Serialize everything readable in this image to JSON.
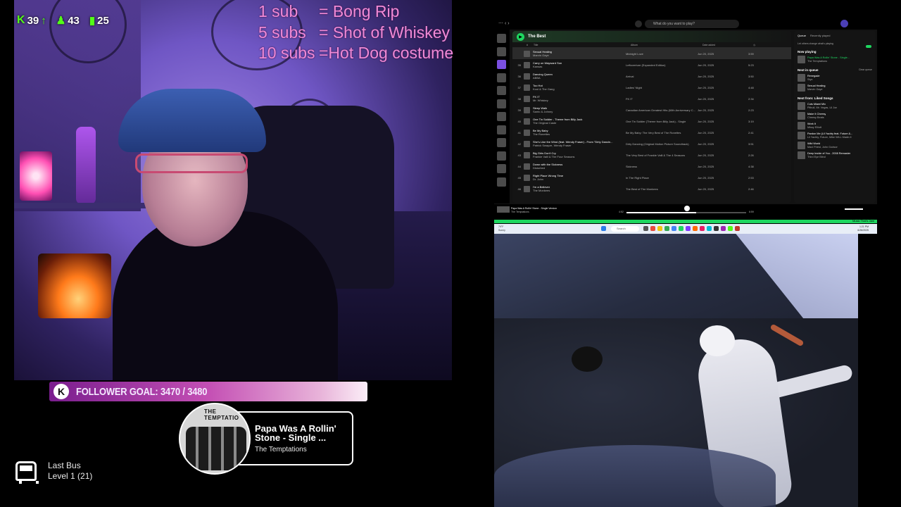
{
  "stats": {
    "kick_count": "39",
    "followers": "43",
    "viewers": "25"
  },
  "sub_goals": [
    {
      "num": "1 sub",
      "reward": "= Bong Rip"
    },
    {
      "num": "5 subs",
      "reward": "= Shot of Whiskey"
    },
    {
      "num": "10 subs",
      "reward": "=Hot Dog costume"
    }
  ],
  "follower_goal": {
    "badge": "K",
    "text": "FOLLOWER GOAL: 3470 / 3480"
  },
  "now_playing": {
    "title": "Papa Was A Rollin' Stone - Single ...",
    "artist": "The Temptations",
    "art_label": "THE TEMPTATIO"
  },
  "last_bus": {
    "title": "Last Bus",
    "level": "Level 1  (21)"
  },
  "spotify": {
    "search_placeholder": "What do you want to play?",
    "playlist_title": "The Best",
    "columns": {
      "num": "#",
      "title": "Title",
      "album": "Album",
      "date": "Date added"
    },
    "tracks": [
      {
        "n": "",
        "title": "Sexual Healing",
        "artist": "Marvin Gaye",
        "album": "Midnight Love",
        "date": "Jun 20, 2025",
        "dur": "3:59",
        "active": true
      },
      {
        "n": "35",
        "title": "Carry on Wayward Son",
        "artist": "Kansas",
        "album": "Leftoverture (Expanded Edition)",
        "date": "Jun 20, 2025",
        "dur": "5:23"
      },
      {
        "n": "36",
        "title": "Dancing Queen",
        "artist": "ABBA",
        "album": "Arrival",
        "date": "Jun 20, 2025",
        "dur": "3:50"
      },
      {
        "n": "37",
        "title": "Too Hot",
        "artist": "Kool & The Gang",
        "album": "Ladies' Night",
        "date": "Jun 20, 2025",
        "dur": "4:48"
      },
      {
        "n": "38",
        "title": "FK IT",
        "artist": "Mr. Whiskey",
        "album": "FK IT",
        "date": "Jun 20, 2025",
        "dur": "2:34"
      },
      {
        "n": "39",
        "title": "Sleep Walk",
        "artist": "Santo & Johnny",
        "album": "Canadian American Greatest Hits (60th Anniversary C...",
        "date": "Jun 20, 2025",
        "dur": "2:23"
      },
      {
        "n": "40",
        "title": "One Tin Soldier - Theme from Billy Jack",
        "artist": "The Original Caste",
        "album": "One Tin Soldier (Theme from Billy Jack) - Single",
        "date": "Jun 20, 2025",
        "dur": "3:19"
      },
      {
        "n": "41",
        "title": "Be My Baby",
        "artist": "The Ronettes",
        "album": "Be My Baby: The Very Best of The Ronettes",
        "date": "Jun 20, 2025",
        "dur": "2:41"
      },
      {
        "n": "42",
        "title": "She's Like the Wind (feat. Wendy Fraser) - From \"Dirty Dancin...",
        "artist": "Patrick Swayze, Wendy Fraser",
        "album": "Dirty Dancing (Original Motion Picture Soundtrack)",
        "date": "Jun 20, 2025",
        "dur": "3:51"
      },
      {
        "n": "43",
        "title": "Big Girls Don't Cry",
        "artist": "Frankie Valli & The Four Seasons",
        "album": "The Very Best of Frankie Valli & The 4 Seasons",
        "date": "Jun 20, 2025",
        "dur": "2:26"
      },
      {
        "n": "44",
        "title": "Down with the Sickness",
        "artist": "Disturbed",
        "album": "Sickness",
        "date": "Jun 20, 2025",
        "dur": "4:38"
      },
      {
        "n": "45",
        "title": "Right Place Wrong Time",
        "artist": "Dr. John",
        "album": "In The Right Place",
        "date": "Jun 20, 2025",
        "dur": "2:53"
      },
      {
        "n": "46",
        "title": "I'm a Believer",
        "artist": "The Monkees",
        "album": "The Best of The Monkees",
        "date": "Jun 20, 2025",
        "dur": "2:46"
      }
    ],
    "queue": {
      "tab_queue": "Queue",
      "tab_recent": "Recently played",
      "autoplay_text": "Let others change what's playing",
      "now_playing_label": "Now playing",
      "now_title": "Papa Was A Rollin' Stone - Single...",
      "now_artist": "The Temptations",
      "next_label": "Next in queue",
      "clear_label": "Clear queue",
      "next": [
        {
          "title": "Renegade",
          "artist": "Styx"
        },
        {
          "title": "Sexual Healing",
          "artist": "Marvin Gaye"
        }
      ],
      "from_label": "Next from: Liked Songs",
      "liked": [
        {
          "title": "Cuts Miami Mix",
          "artist": "Pitbull, Mr. Vegas, Lil Jon"
        },
        {
          "title": "Make It Cheesy",
          "artist": "Cheesy Beats"
        },
        {
          "title": "Work It",
          "artist": "Missy Elliott"
        },
        {
          "title": "Pardon Me (Lil Yachty feat. Future &...",
          "artist": "Lil Yachty, Future, Mike WiLL Made-It"
        },
        {
          "title": "Wild World",
          "artist": "Maxi Priest, John Godson"
        },
        {
          "title": "Deep Inside of You - 2008 Remaster",
          "artist": "Third Eye Blind"
        }
      ]
    },
    "player": {
      "title": "Papa Was A Rollin' Stone - Single Version",
      "artist": "The Temptations",
      "elapsed": "4:52",
      "total": "6:59",
      "progress": 0.58
    },
    "greenbar_text": "Music That's Jam"
  },
  "taskbar": {
    "search": "Search",
    "time": "1:21 PM",
    "date": "6/26/2025",
    "weather_temp": "79°F",
    "weather_desc": "Sunny"
  },
  "colors": {
    "accent_green": "#53fc18",
    "spotify_green": "#1ed760",
    "sub_pink": "#f08ad7"
  }
}
